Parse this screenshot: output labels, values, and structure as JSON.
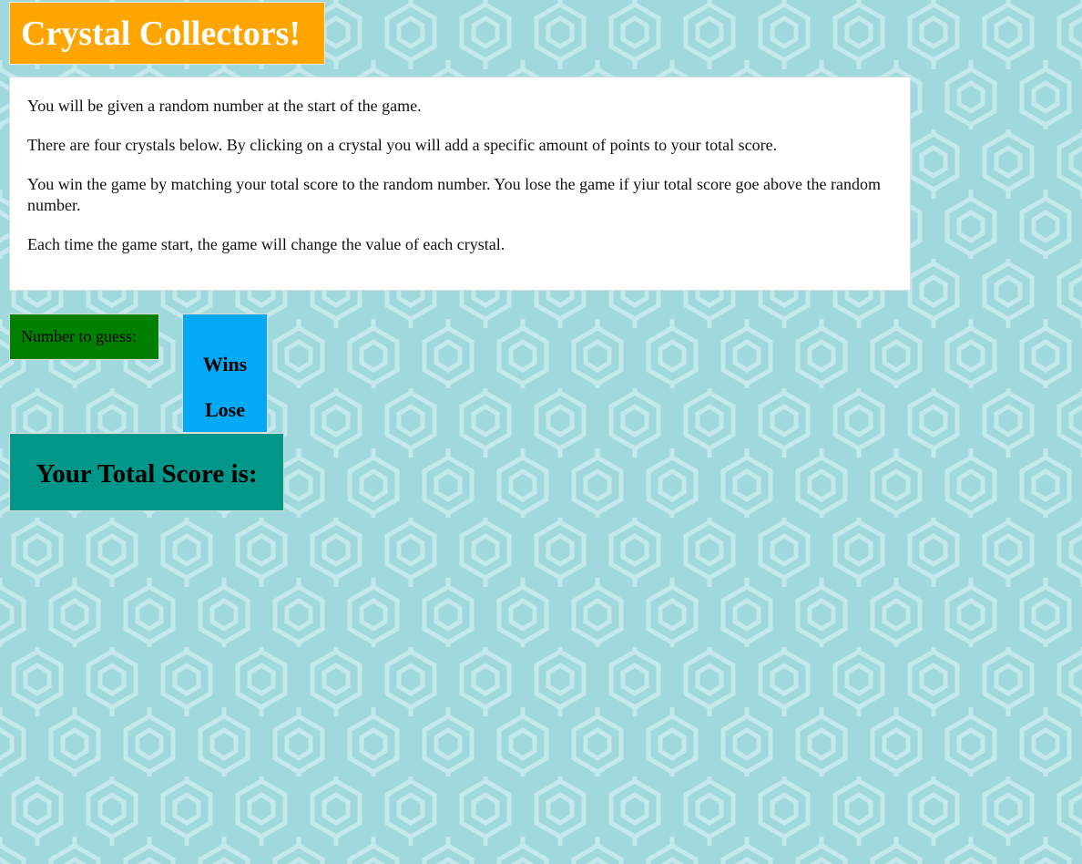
{
  "header": {
    "title": "Crystal Collectors!"
  },
  "instructions": {
    "paragraphs": [
      "You will be given a random number at the start of the game.",
      "There are four crystals below. By clicking on a crystal you will add a specific amount of points to your total score.",
      "You win the game by matching your total score to the random number. You lose the game if yiur total score goe above the random number.",
      "Each time the game start, the game will change the value of each crystal."
    ]
  },
  "game": {
    "number_to_guess_label": "Number to guess:",
    "wins_label": "Wins",
    "lose_label": "Lose",
    "total_score_label": "Your Total Score is:"
  },
  "colors": {
    "background": "#9fd9de",
    "pattern": "#c4e9ec",
    "title_bg": "#ffa500",
    "guess_bg": "#008000",
    "stats_bg": "#03a9f4",
    "score_bg": "#009688"
  },
  "icons": {
    "background_pattern": "hexagon-pattern"
  }
}
